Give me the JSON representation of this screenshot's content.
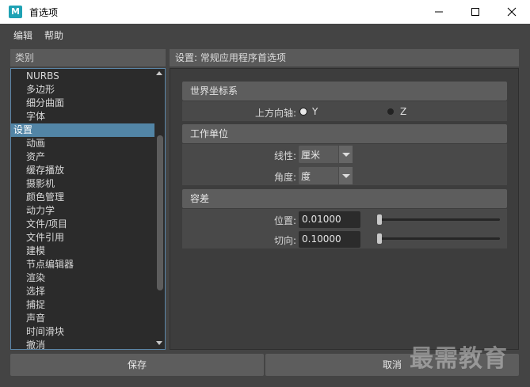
{
  "window": {
    "title": "首选项",
    "app_icon_letter": "M",
    "controls": [
      "minimize-icon",
      "maximize-icon",
      "close-icon"
    ]
  },
  "menubar": {
    "items": [
      "编辑",
      "帮助"
    ]
  },
  "categories": {
    "header": "类别",
    "items": [
      {
        "label": "NURBS",
        "level": "sub"
      },
      {
        "label": "多边形",
        "level": "sub"
      },
      {
        "label": "细分曲面",
        "level": "sub"
      },
      {
        "label": "字体",
        "level": "sub"
      },
      {
        "label": "设置",
        "level": "top",
        "selected": true
      },
      {
        "label": "动画",
        "level": "sub"
      },
      {
        "label": "资产",
        "level": "sub"
      },
      {
        "label": "缓存播放",
        "level": "sub"
      },
      {
        "label": "摄影机",
        "level": "sub"
      },
      {
        "label": "颜色管理",
        "level": "sub"
      },
      {
        "label": "动力学",
        "level": "sub"
      },
      {
        "label": "文件/项目",
        "level": "sub"
      },
      {
        "label": "文件引用",
        "level": "sub"
      },
      {
        "label": "建模",
        "level": "sub"
      },
      {
        "label": "节点编辑器",
        "level": "sub"
      },
      {
        "label": "渲染",
        "level": "sub"
      },
      {
        "label": "选择",
        "level": "sub"
      },
      {
        "label": "捕捉",
        "level": "sub"
      },
      {
        "label": "声音",
        "level": "sub"
      },
      {
        "label": "时间滑块",
        "level": "sub"
      },
      {
        "label": "撤消",
        "level": "sub"
      }
    ]
  },
  "panel": {
    "header": "设置: 常规应用程序首选项",
    "world": {
      "title": "世界坐标系",
      "up_axis_label": "上方向轴:",
      "options": [
        "Y",
        "Z"
      ],
      "selected": "Y"
    },
    "units": {
      "title": "工作单位",
      "linear_label": "线性:",
      "linear_value": "厘米",
      "angular_label": "角度:",
      "angular_value": "度"
    },
    "tolerance": {
      "title": "容差",
      "position_label": "位置:",
      "position_value": "0.01000",
      "tangent_label": "切向:",
      "tangent_value": "0.10000"
    }
  },
  "buttons": {
    "save": "保存",
    "cancel": "取消"
  },
  "watermark": "最需教育"
}
